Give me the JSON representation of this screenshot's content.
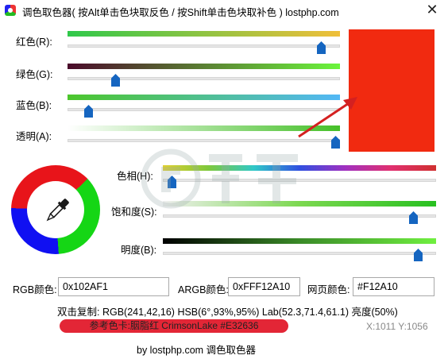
{
  "window": {
    "title": "调色取色器( 按Alt单击色块取反色 / 按Shift单击色块取补色 ) lostphp.com",
    "close_glyph": "✕"
  },
  "sliders_rgba": [
    {
      "label": "红色(R):",
      "value": 241,
      "max": 255,
      "gradient": [
        "#2fc84a",
        "#f0bf3a"
      ]
    },
    {
      "label": "绿色(G):",
      "value": 42,
      "max": 255,
      "gradient": [
        "#4a0a2a",
        "#6bf53c"
      ]
    },
    {
      "label": "蓝色(B):",
      "value": 16,
      "max": 255,
      "gradient": [
        "#4cc62c",
        "#52b8f6"
      ]
    },
    {
      "label": "透明(A):",
      "value": 255,
      "max": 255,
      "gradient": [
        "#ffffff",
        "#45c028"
      ]
    }
  ],
  "sliders_hsb": [
    {
      "label": "色相(H):",
      "value": 6,
      "max": 360
    },
    {
      "label": "饱和度(S):",
      "value": 93,
      "max": 100
    },
    {
      "label": "明度(B):",
      "value": 95,
      "max": 100
    }
  ],
  "preview_color": "#F12A10",
  "fields": {
    "rgb_label": "RGB颜色:",
    "rgb_value": "0x102AF1",
    "argb_label": "ARGB颜色:",
    "argb_value": "0xFFF12A10",
    "web_label": "网页颜色:",
    "web_value": "#F12A10"
  },
  "info_line": "双击复制: RGB(241,42,16) HSB(6°,93%,95%) Lab(52.3,71.4,61.1) 亮度(50%)",
  "reference": {
    "text": "参考色卡:胭脂红  CrimsonLake  #E32636",
    "color": "#E32636"
  },
  "coords": "X:1011  Y:1056",
  "footer": "by lostphp.com 调色取色器",
  "icons": {
    "app": "color-wheel-icon",
    "tool": "eyedropper-icon",
    "watermark": "site-watermark-icon"
  },
  "accent_colors": {
    "thumb": "#1565c0",
    "arrow": "#d42020"
  }
}
